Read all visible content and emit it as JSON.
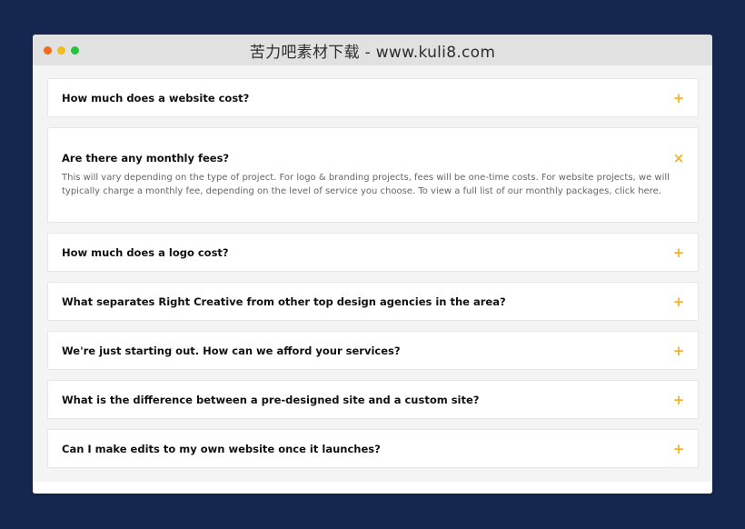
{
  "window": {
    "title": "苦力吧素材下载 - www.kuli8.com",
    "traffic_lights": [
      "#f06b1d",
      "#f1bb1b",
      "#27c13a"
    ]
  },
  "colors": {
    "background": "#15274f",
    "accent": "#f0b429"
  },
  "faq": {
    "items": [
      {
        "question": "How much does a website cost?",
        "icon": "plus-icon",
        "symbol": "+",
        "open": false
      },
      {
        "question": "Are there any monthly fees?",
        "icon": "close-icon",
        "symbol": "×",
        "open": true,
        "answer": "This will vary depending on the type of project. For logo & branding projects, fees will be one-time costs. For website projects, we will typically charge a monthly fee, depending on the level of service you choose. To view a full list of our monthly packages, click here."
      },
      {
        "question": "How much does a logo cost?",
        "icon": "plus-icon",
        "symbol": "+",
        "open": false
      },
      {
        "question": "What separates Right Creative from other top design agencies in the area?",
        "icon": "plus-icon",
        "symbol": "+",
        "open": false
      },
      {
        "question": "We're just starting out. How can we afford your services?",
        "icon": "plus-icon",
        "symbol": "+",
        "open": false
      },
      {
        "question": "What is the difference between a pre-designed site and a custom site?",
        "icon": "plus-icon",
        "symbol": "+",
        "open": false
      },
      {
        "question": "Can I make edits to my own website once it launches?",
        "icon": "plus-icon",
        "symbol": "+",
        "open": false
      }
    ]
  }
}
